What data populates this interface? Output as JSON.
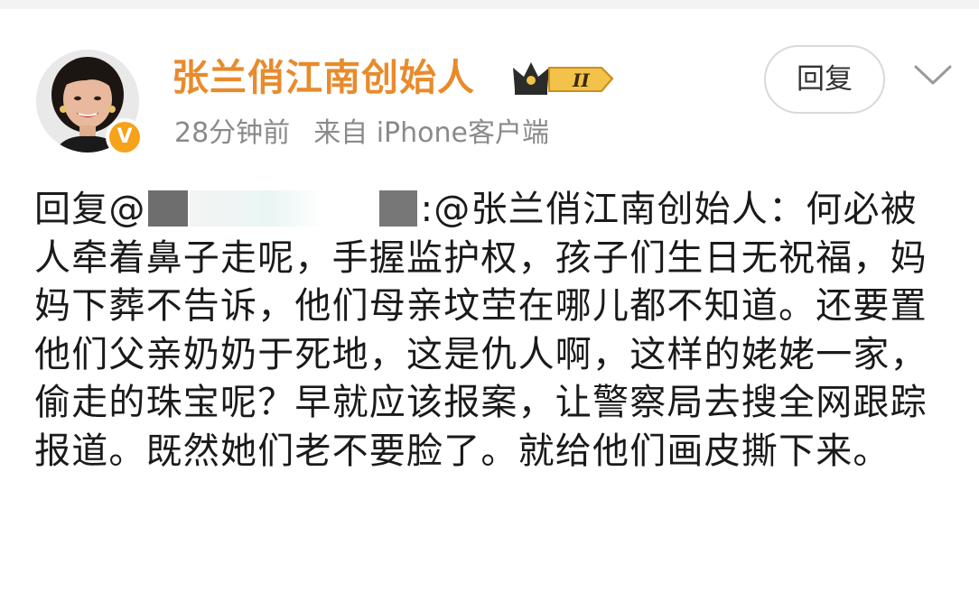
{
  "post": {
    "author_name": "张兰俏江南创始人",
    "level_badge": "II",
    "verified_mark": "V",
    "time": "28分钟前",
    "source": "来自 iPhone客户端",
    "reply_button_label": "回复",
    "menu_icon": "chevron-down-icon"
  },
  "comment": {
    "reply_prefix": "回复@",
    "mention_target": ":@张兰俏江南创始人",
    "text": "：何必被人牵着鼻子走呢，手握监护权，孩子们生日无祝福，妈妈下葬不告诉，他们母亲坟茔在哪儿都不知道。还要置他们父亲奶奶于死地，这是仇人啊，这样的姥姥一家，偷走的珠宝呢？早就应该报案，让警察局去搜全网跟踪报道。既然她们老不要脸了。就给他们画皮撕下来。"
  },
  "colors": {
    "author_name": "#e88b2c",
    "meta_text": "#8a8a8a",
    "badge_gold": "#f7a21b",
    "body_text": "#1a1a1a"
  }
}
